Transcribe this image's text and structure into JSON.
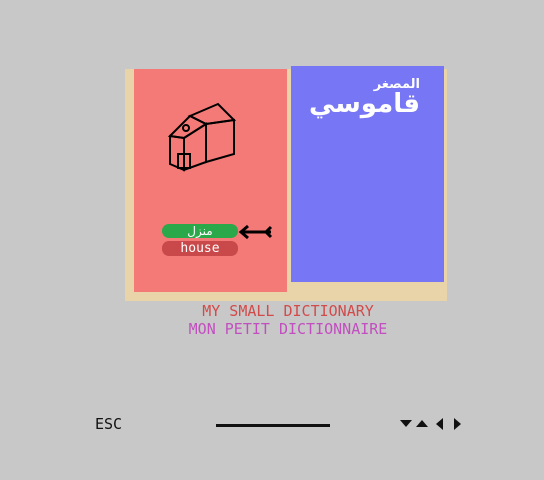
{
  "book": {
    "title_arabic_small": "المصغر",
    "title_arabic_big": "قاموسي",
    "word_arabic": "منزل",
    "word_english": "house",
    "picture_icon": "house-icon",
    "pointer_icon": "arrow-left-icon"
  },
  "titles": {
    "english": "MY SMALL DICTIONARY",
    "french": "MON PETIT DICTIONNAIRE"
  },
  "footer": {
    "esc_label": "ESC",
    "navigation_icons": [
      "down-arrow-icon",
      "up-arrow-icon",
      "left-arrow-icon",
      "right-arrow-icon"
    ]
  },
  "colors": {
    "background": "#c8c8c8",
    "left_page": "#f47a78",
    "right_page": "#7777f5",
    "book_edge": "#e8d4a8",
    "arabic_word_badge": "#2aa84a",
    "english_word_badge": "#c9484a",
    "english_title": "#d24b4b",
    "french_title": "#c24fc0"
  }
}
